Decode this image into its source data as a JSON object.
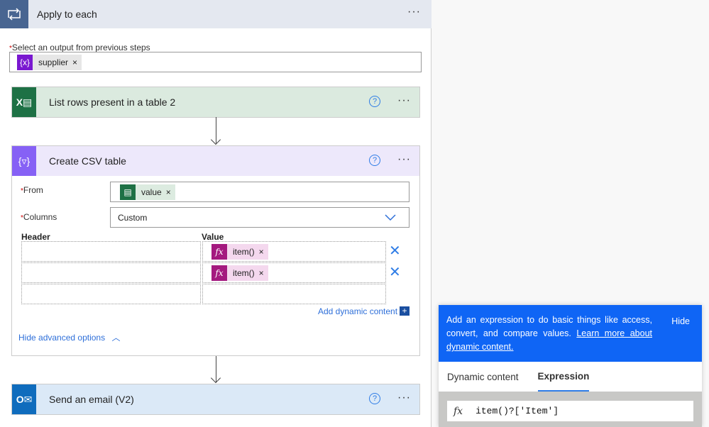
{
  "apply_each": {
    "title": "Apply to each",
    "select_label": "Select an output from previous steps",
    "token": {
      "label": "supplier",
      "icon": "variable-icon"
    }
  },
  "list_rows": {
    "title": "List rows present in a table 2",
    "icon": "excel-icon"
  },
  "csv": {
    "title": "Create CSV table",
    "icon": "data-operation-icon",
    "from_label": "From",
    "from_token": "value",
    "columns_label": "Columns",
    "columns_value": "Custom",
    "header_label": "Header",
    "value_label": "Value",
    "rows": [
      {
        "header": "",
        "value": "item()"
      },
      {
        "header": "",
        "value": "item()"
      },
      {
        "header": "",
        "value": ""
      }
    ],
    "add_dynamic": "Add dynamic content",
    "hide_advanced": "Hide advanced options"
  },
  "send_email": {
    "title": "Send an email (V2)",
    "icon": "outlook-icon"
  },
  "popup": {
    "info": "Add an expression to do basic things like access, convert, and compare values. ",
    "learn_more": "Learn more about dynamic content.",
    "hide": "Hide",
    "tabs": [
      {
        "label": "Dynamic content",
        "active": false
      },
      {
        "label": "Expression",
        "active": true
      }
    ],
    "expression": "item()?['Item']"
  },
  "colors": {
    "accent": "#0f65f5",
    "excel": "#1e7145",
    "csv": "#8661f5",
    "outlook": "#0f6cbd",
    "expression_token": "#a4197f"
  }
}
